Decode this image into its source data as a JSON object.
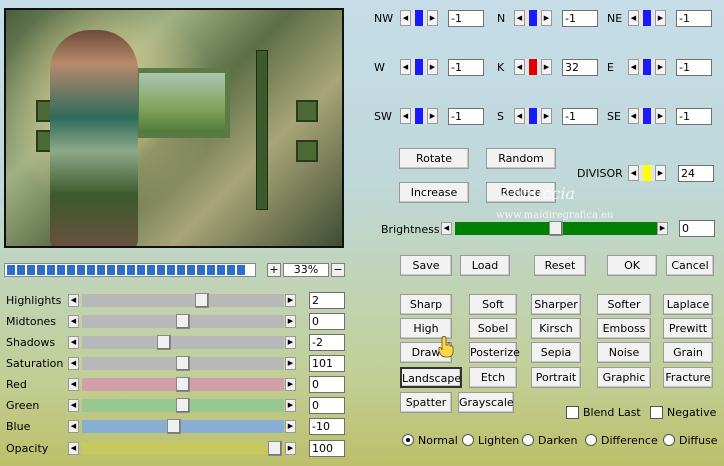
{
  "zoom": {
    "plus": "+",
    "minus": "−",
    "value": "33%"
  },
  "sliders": [
    {
      "key": "highlights",
      "label": "Highlights",
      "value": "2",
      "level": 0.6,
      "color": "#b8b8b8"
    },
    {
      "key": "midtones",
      "label": "Midtones",
      "value": "0",
      "level": 0.5,
      "color": "#b8b8b8"
    },
    {
      "key": "shadows",
      "label": "Shadows",
      "value": "-2",
      "level": 0.4,
      "color": "#b8b8b8"
    },
    {
      "key": "saturation",
      "label": "Saturation",
      "value": "101",
      "level": 0.5,
      "color": "#b8b8b8"
    },
    {
      "key": "red",
      "label": "Red",
      "value": "0",
      "level": 0.5,
      "color": "#d2a0a8"
    },
    {
      "key": "green",
      "label": "Green",
      "value": "0",
      "level": 0.5,
      "color": "#98c890"
    },
    {
      "key": "blue",
      "label": "Blue",
      "value": "-10",
      "level": 0.45,
      "color": "#88aed4"
    },
    {
      "key": "opacity",
      "label": "Opacity",
      "value": "100",
      "level": 0.99,
      "color": "#c8c860"
    }
  ],
  "kernel": [
    {
      "label": "NW",
      "value": "-1",
      "color": "#1a1aff"
    },
    {
      "label": "N",
      "value": "-1",
      "color": "#1a1aff"
    },
    {
      "label": "NE",
      "value": "-1",
      "color": "#1a1aff"
    },
    {
      "label": "W",
      "value": "-1",
      "color": "#1a1aff"
    },
    {
      "label": "K",
      "value": "32",
      "color": "#e00000"
    },
    {
      "label": "E",
      "value": "-1",
      "color": "#1a1aff"
    },
    {
      "label": "SW",
      "value": "-1",
      "color": "#1a1aff"
    },
    {
      "label": "S",
      "value": "-1",
      "color": "#1a1aff"
    },
    {
      "label": "SE",
      "value": "-1",
      "color": "#1a1aff"
    }
  ],
  "kernel_buttons": {
    "rotate": "Rotate",
    "random": "Random",
    "increase": "Increase",
    "reduce": "Reduce"
  },
  "divisor": {
    "label": "DIVISOR",
    "value": "24",
    "color": "#ffff00"
  },
  "brightness": {
    "label": "Brightness",
    "value": "0",
    "level": 0.5,
    "color": "#008000"
  },
  "actions": {
    "save": "Save",
    "load": "Load",
    "reset": "Reset",
    "ok": "OK",
    "cancel": "Cancel"
  },
  "presets": [
    [
      "Sharp",
      "Soft",
      "Sharper",
      "Softer",
      "Laplace"
    ],
    [
      "High Pass",
      "Sobel",
      "Kirsch",
      "Emboss",
      "Prewitt"
    ],
    [
      "Draw",
      "Posterize",
      "Sepia",
      "Noise",
      "Grain"
    ],
    [
      "Landscape",
      "Etch",
      "Portrait",
      "Graphic",
      "Fracture"
    ],
    [
      "Spatter",
      "Grayscale"
    ]
  ],
  "selected_preset": "Landscape",
  "checkboxes": {
    "blend_last": "Blend Last",
    "negative": "Negative"
  },
  "modes": [
    "Normal",
    "Lighten",
    "Darken",
    "Difference",
    "Diffuse"
  ],
  "selected_mode": "Normal",
  "watermark": {
    "line1": "Annuccia",
    "line2": "www.maidiregrafica.eu"
  },
  "icons": [
    "hand-pointer-icon"
  ]
}
